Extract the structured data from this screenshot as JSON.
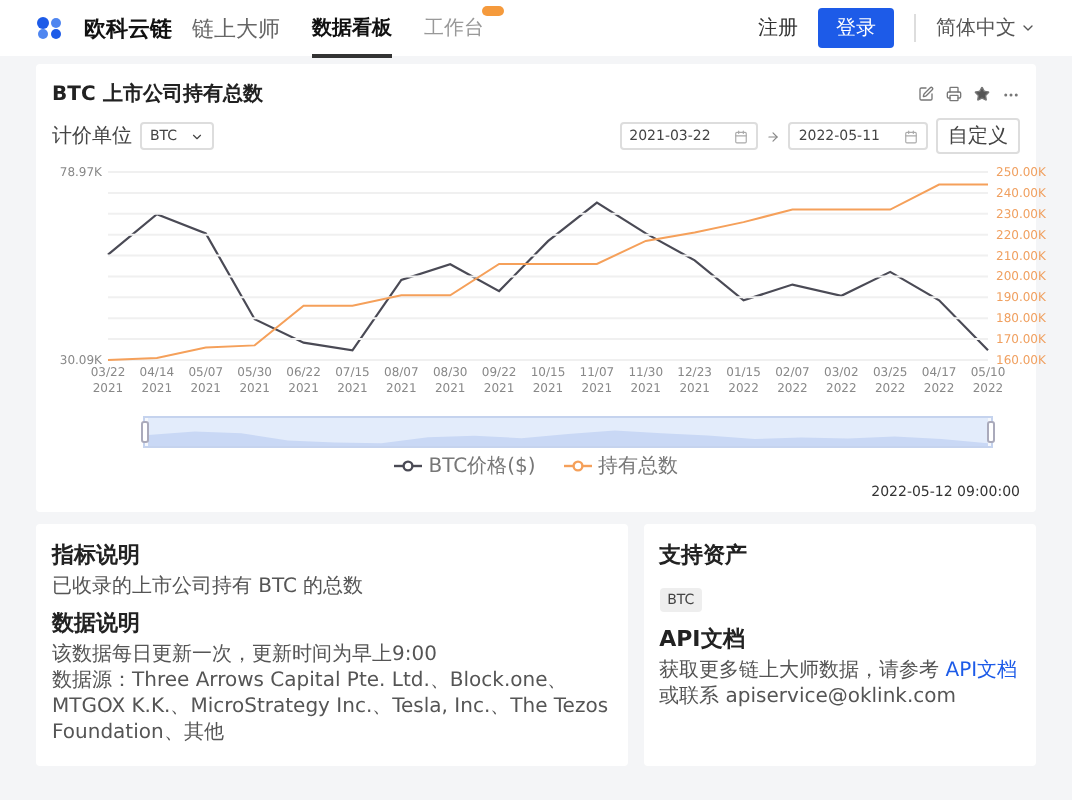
{
  "header": {
    "brand": "欧科云链",
    "product": "链上大师",
    "tabs": [
      {
        "label": "数据看板",
        "selected": true,
        "badge": false
      },
      {
        "label": "工作台",
        "selected": false,
        "badge": true
      }
    ],
    "register": "注册",
    "login": "登录",
    "language": "简体中文"
  },
  "panel": {
    "title": "BTC 上市公司持有总数",
    "unit_label": "计价单位",
    "unit": "BTC",
    "start_date": "2021-03-22",
    "end_date": "2022-05-11",
    "custom_button": "自定义",
    "chart_data": {
      "type": "line",
      "categories": [
        "03/22 2021",
        "04/14 2021",
        "05/07 2021",
        "05/30 2021",
        "06/22 2021",
        "07/15 2021",
        "08/07 2021",
        "08/30 2021",
        "09/22 2021",
        "10/15 2021",
        "11/07 2021",
        "11/30 2021",
        "12/23 2021",
        "01/15 2022",
        "02/07 2022",
        "03/02 2022",
        "03/25 2022",
        "04/17 2022",
        "05/10 2022"
      ],
      "series": [
        {
          "name": "BTC价格($)",
          "color": "#4a4a55",
          "values": [
            57.5,
            68,
            63,
            40.7,
            34.6,
            32.6,
            50.9,
            55,
            48,
            61,
            71,
            63,
            56,
            45.6,
            49.7,
            46.8,
            53,
            45.6,
            32.6
          ]
        }
      ],
      "ylim": [
        30.09,
        78.97
      ],
      "yticks": [
        {
          "value": 30.09,
          "label": "30.09K"
        },
        {
          "value": 78.97,
          "label": "78.97K"
        }
      ]
    },
    "holdings_chart": {
      "chart_data": {
        "type": "line",
        "series": [
          {
            "name": "持有总数",
            "color": "#f5a05a",
            "values": [
              160,
              161,
              166,
              167,
              186,
              186,
              191,
              191,
              206,
              206,
              206,
              217,
              221,
              226,
              232,
              232,
              232,
              244,
              244
            ]
          }
        ],
        "grid": true,
        "ylim": [
          160,
          250
        ],
        "yticks": [
          {
            "value": 160,
            "label": "160.00K"
          },
          {
            "value": 170,
            "label": "170.00K"
          },
          {
            "value": 180,
            "label": "180.00K"
          },
          {
            "value": 190,
            "label": "190.00K"
          },
          {
            "value": 200,
            "label": "200.00K"
          },
          {
            "value": 210,
            "label": "210.00K"
          },
          {
            "value": 220,
            "label": "220.00K"
          },
          {
            "value": 230,
            "label": "230.00K"
          },
          {
            "value": 240,
            "label": "240.00K"
          },
          {
            "value": 250,
            "label": "250.00K"
          }
        ]
      }
    },
    "zoom_slider": {
      "level": 1
    },
    "timestamp": "2022-05-12 09:00:00"
  },
  "info": {
    "sections": [
      {
        "heading": "指标说明",
        "lines": [
          "已收录的上市公司持有 BTC 的总数"
        ]
      },
      {
        "heading": "数据说明",
        "lines": [
          "该数据每日更新一次，更新时间为早上9:00",
          "数据源：Three Arrows Capital Pte. Ltd.、Block.one、MTGOX K.K.、MicroStrategy Inc.、Tesla, Inc.、The Tezos Foundation、其他"
        ]
      }
    ]
  },
  "assets": {
    "heading": "支持资产",
    "tags": [
      "BTC"
    ],
    "api_heading": "API文档",
    "api_text": "获取更多链上大师数据，请参考 ",
    "api_link": "API文档",
    "api_text_after": " 或联系",
    "api_email": "apiservice@oklink.com"
  }
}
